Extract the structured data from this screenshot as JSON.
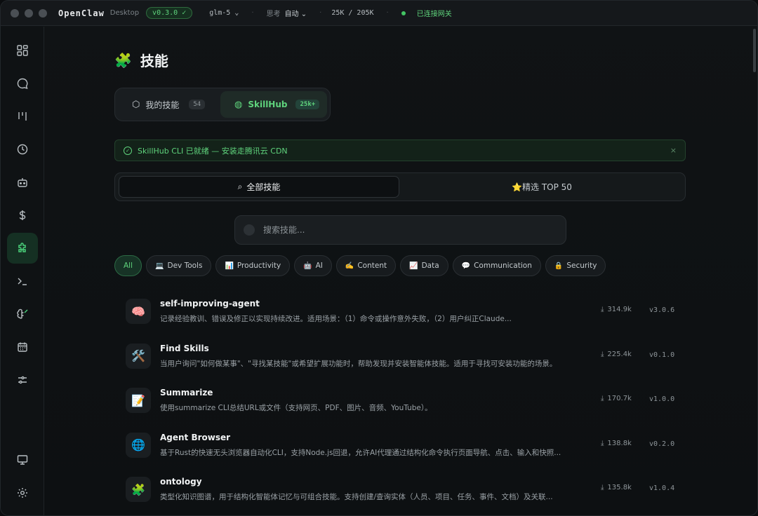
{
  "titlebar": {
    "app_name": "OpenClaw",
    "app_sub": "Desktop",
    "version": "v0.3.0 ✓",
    "model": "glm-5 ⌄",
    "think_label": "思考",
    "think_value": "自动 ⌄",
    "tokens": "25K / 205K",
    "connection": "已连接网关"
  },
  "page": {
    "title": "技能",
    "title_icon": "🧩"
  },
  "segment": {
    "mine_label": "我的技能",
    "mine_count": "54",
    "hub_label": "SkillHub",
    "hub_count": "25k+"
  },
  "notice": {
    "text": "SkillHub CLI 已就绪 — 安装走腾讯云 CDN",
    "close": "×"
  },
  "filter_tabs": {
    "all_label": "全部技能",
    "top_label": "⭐精选 TOP 50"
  },
  "search": {
    "placeholder": "搜索技能..."
  },
  "chips": [
    {
      "emoji": "",
      "label": "All"
    },
    {
      "emoji": "💻",
      "label": "Dev Tools"
    },
    {
      "emoji": "📊",
      "label": "Productivity"
    },
    {
      "emoji": "🤖",
      "label": "AI"
    },
    {
      "emoji": "✍️",
      "label": "Content"
    },
    {
      "emoji": "📈",
      "label": "Data"
    },
    {
      "emoji": "💬",
      "label": "Communication"
    },
    {
      "emoji": "🔒",
      "label": "Security"
    }
  ],
  "skills": [
    {
      "icon": "🧠",
      "name": "self-improving-agent",
      "desc": "记录经验教训、错误及修正以实现持续改进。适用场景：（1）命令或操作意外失败，（2）用户纠正Claude...",
      "downloads": "314.9k",
      "version": "v3.0.6"
    },
    {
      "icon": "🛠️",
      "name": "Find Skills",
      "desc": "当用户询问\"如何做某事\"、\"寻找某技能\"或希望扩展功能时，帮助发现并安装智能体技能。适用于寻找可安装功能的场景。",
      "downloads": "225.4k",
      "version": "v0.1.0"
    },
    {
      "icon": "📝",
      "name": "Summarize",
      "desc": "使用summarize CLI总结URL或文件（支持网页、PDF、图片、音频、YouTube）。",
      "downloads": "170.7k",
      "version": "v1.0.0"
    },
    {
      "icon": "🌐",
      "name": "Agent Browser",
      "desc": "基于Rust的快速无头浏览器自动化CLI，支持Node.js回退，允许AI代理通过结构化命令执行页面导航、点击、输入和快照...",
      "downloads": "138.8k",
      "version": "v0.2.0"
    },
    {
      "icon": "🧩",
      "name": "ontology",
      "desc": "类型化知识图谱，用于结构化智能体记忆与可组合技能。支持创建/查询实体（人员、项目、任务、事件、文档）及关联...",
      "downloads": "135.8k",
      "version": "v1.0.4"
    }
  ]
}
